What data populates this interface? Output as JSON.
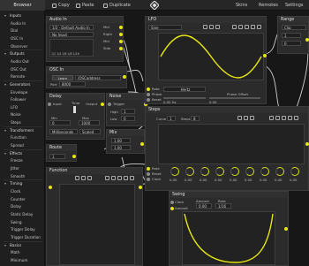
{
  "toolbar": {
    "browser_tab": "Browser",
    "copy": "Copy",
    "paste": "Paste",
    "duplicate": "Duplicate",
    "skins": "Skins",
    "remotes": "Remotes",
    "settings": "Settings"
  },
  "sidebar": {
    "items": [
      {
        "label": "Inputs",
        "type": "category"
      },
      {
        "label": "Audio In",
        "type": "item"
      },
      {
        "label": "Dial",
        "type": "item"
      },
      {
        "label": "OSC In",
        "type": "item"
      },
      {
        "label": "Observer",
        "type": "item"
      },
      {
        "label": "Outputs",
        "type": "category"
      },
      {
        "label": "Audio Out",
        "type": "item"
      },
      {
        "label": "OSC Out",
        "type": "item"
      },
      {
        "label": "Remote",
        "type": "item"
      },
      {
        "label": "Generators",
        "type": "category"
      },
      {
        "label": "Envelope",
        "type": "item"
      },
      {
        "label": "Follower",
        "type": "item"
      },
      {
        "label": "LFO",
        "type": "item"
      },
      {
        "label": "Noise",
        "type": "item"
      },
      {
        "label": "Steps",
        "type": "item"
      },
      {
        "label": "Transformers",
        "type": "category"
      },
      {
        "label": "Function",
        "type": "item"
      },
      {
        "label": "Spread",
        "type": "item"
      },
      {
        "label": "Effects",
        "type": "category"
      },
      {
        "label": "Freeze",
        "type": "item"
      },
      {
        "label": "Jitter",
        "type": "item"
      },
      {
        "label": "Smooth",
        "type": "item"
      },
      {
        "label": "Timing",
        "type": "category"
      },
      {
        "label": "Clock",
        "type": "item"
      },
      {
        "label": "Counter",
        "type": "item"
      },
      {
        "label": "Delay",
        "type": "item"
      },
      {
        "label": "Static Delay",
        "type": "item"
      },
      {
        "label": "Swing",
        "type": "item"
      },
      {
        "label": "Trigger Delay",
        "type": "item"
      },
      {
        "label": "Trigger Duration",
        "type": "item"
      },
      {
        "label": "Basics",
        "type": "category"
      },
      {
        "label": "Math",
        "type": "item"
      },
      {
        "label": "Minimum",
        "type": "item"
      }
    ]
  },
  "modules": {
    "audio_in": {
      "title": "Audio In",
      "device": "1/2 - Default Audio In",
      "input": "No Input",
      "ports": [
        "Mid",
        "Right",
        "Mid",
        "Side"
      ],
      "meter": "1/2   1/4   1/6   1/8   1/16"
    },
    "osc_in": {
      "title": "OSC In",
      "learn": "Learn",
      "address": "/OSCaddress",
      "port_label": "Port",
      "port_value": "8000"
    },
    "delay": {
      "title": "Delay",
      "input": "Input",
      "time": "Time",
      "output": "Output",
      "min_label": "Min",
      "max_label": "Max",
      "min_value": "0",
      "max_value": "1000",
      "units": "Milliseconds",
      "mode": "Scaled"
    },
    "noise": {
      "title": "Noise",
      "trigger": "Trigger",
      "high_label": "High",
      "high_value": "1",
      "low_label": "Low",
      "low_value": "0"
    },
    "mix": {
      "title": "Mix",
      "value_1": "1.00",
      "value_2": "1.00"
    },
    "route": {
      "title": "Route",
      "value": "1"
    },
    "function": {
      "title": "Function"
    },
    "lfo": {
      "title": "LFO",
      "waveform": "Sine",
      "ports": [
        "Rate",
        "Phase",
        "Reset"
      ],
      "rate_unit": "Hertz",
      "phase_label": "Phase Offset",
      "rate_value": "0.00 Hz",
      "phase_value": "0.00"
    },
    "range": {
      "title": "Range",
      "mode": "Clip",
      "value_1": "1",
      "value_2": "0"
    },
    "steps": {
      "title": "Steps",
      "curve_label": "Curve",
      "curve_value": "1",
      "steps_label": "Steps",
      "steps_value": "8",
      "ports": [
        "Rate",
        "Reset",
        "Clock"
      ],
      "knob_values": [
        "0.00",
        "0.00",
        "0.00",
        "0.00",
        "0.00",
        "0.00",
        "0.00",
        "0.00",
        "0.00"
      ]
    },
    "swing": {
      "title": "Swing",
      "clock": "Clock",
      "amount_label": "Amount",
      "amount_value": "0.00",
      "rate_label": "Rate",
      "rate_value": "1/16",
      "amount_port": "Amount"
    }
  },
  "colors": {
    "accent": "#e6e610",
    "panel": "#2b2b2b",
    "canvas": "#171717"
  }
}
